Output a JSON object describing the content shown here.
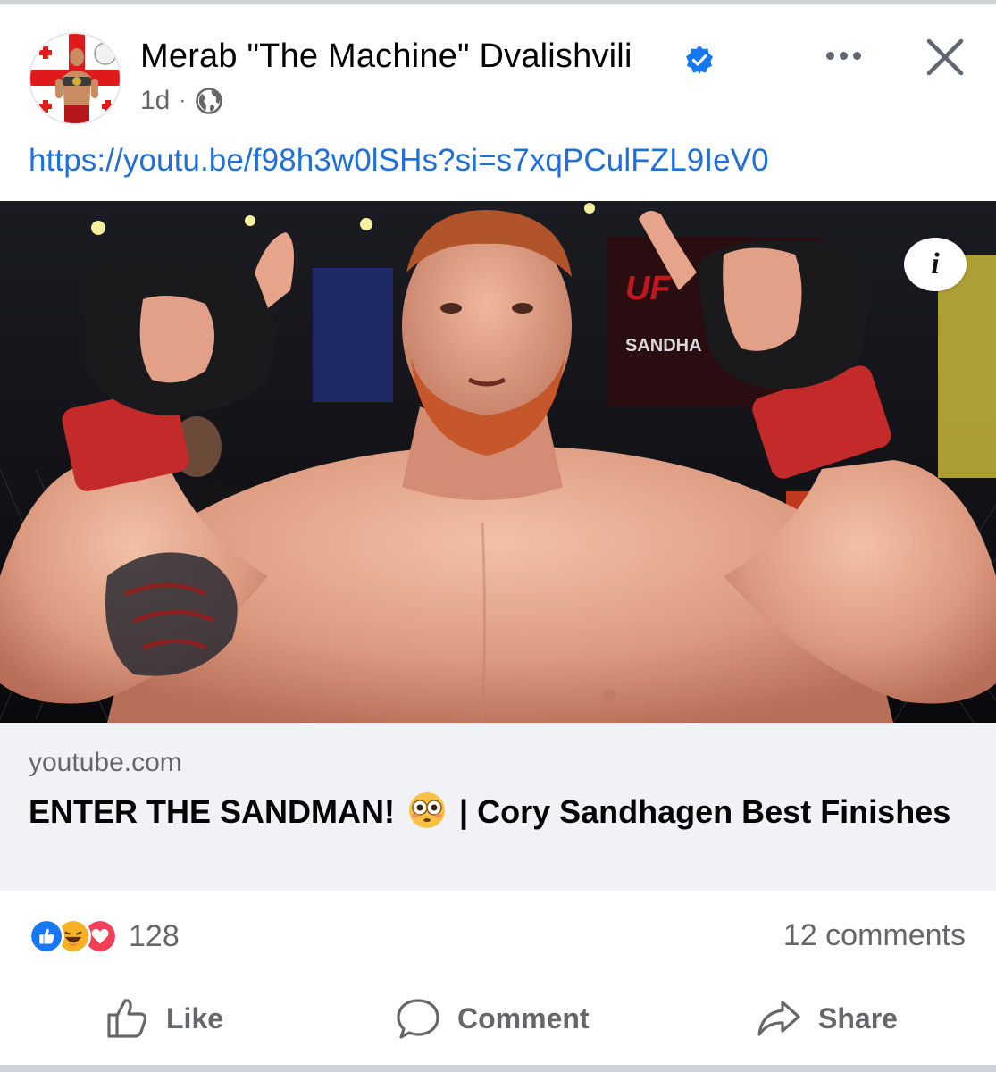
{
  "post": {
    "author": "Merab \"The Machine\" Dvalishvili",
    "time": "1d",
    "separator": "·",
    "link_text": "https://youtu.be/f98h3w0lSHs?si=s7xqPCulFZL9IeV0"
  },
  "icons": {
    "verified": "verified-badge-icon",
    "globe": "public-globe-icon",
    "more": "more-options-icon",
    "close": "close-icon",
    "info": "info-icon",
    "like": "thumbs-up-icon",
    "comment": "comment-bubble-icon",
    "share": "share-arrow-icon"
  },
  "info_glyph": "i",
  "preview": {
    "domain": "youtube.com",
    "title_before": "ENTER THE SANDMAN!",
    "title_after": "| Cory Sandhagen Best Finishes"
  },
  "stats": {
    "reaction_count": "128",
    "comments": "12 comments"
  },
  "actions": {
    "like": "Like",
    "comment": "Comment",
    "share": "Share"
  },
  "colors": {
    "link": "#216fdb",
    "secondary_text": "#65676b",
    "preview_bg": "#f0f2f5",
    "like_blue": "#1877f2",
    "love_red": "#f33e58",
    "haha_yellow": "#f7b125"
  }
}
